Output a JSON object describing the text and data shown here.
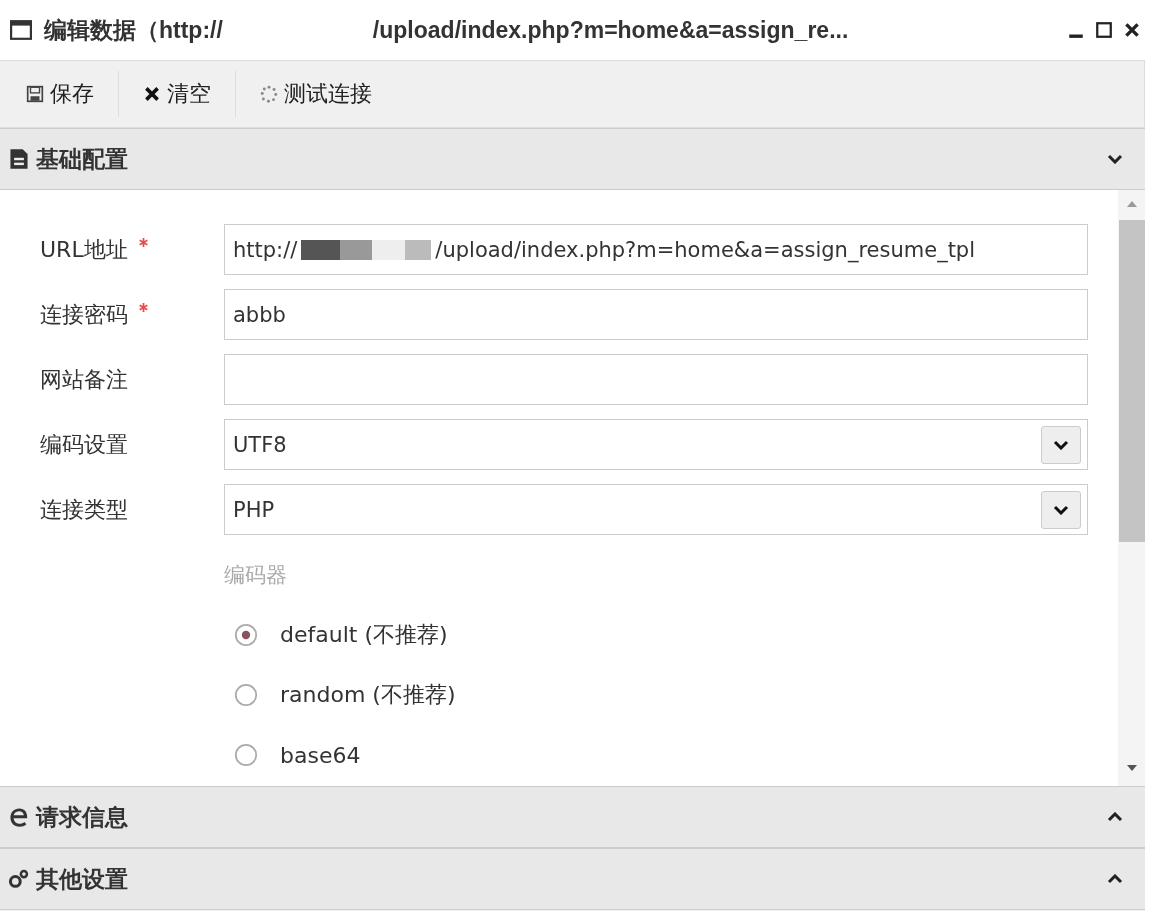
{
  "window": {
    "title_parts": [
      "编辑数据（http://",
      "/upload/index.php?m=home&a=assign_re..."
    ]
  },
  "toolbar": [
    {
      "label": "保存"
    },
    {
      "label": "清空"
    },
    {
      "label": "测试连接"
    }
  ],
  "sections": [
    {
      "title": "基础配置",
      "expanded": true
    },
    {
      "title": "请求信息",
      "expanded": false
    },
    {
      "title": "其他设置",
      "expanded": false
    }
  ],
  "fields": [
    {
      "kind": "text",
      "label": "URL地址",
      "required": true,
      "value_parts": [
        "http://",
        "/upload/index.php?m=home&a=assign_resume_tpl"
      ]
    },
    {
      "kind": "text",
      "label": "连接密码",
      "required": true,
      "value_parts": [
        "abbb"
      ]
    },
    {
      "kind": "text",
      "label": "网站备注",
      "required": false
    },
    {
      "kind": "select",
      "label": "编码设置",
      "required": false,
      "value_parts": [
        "UTF8"
      ]
    },
    {
      "kind": "select",
      "label": "连接类型",
      "required": false,
      "value_parts": [
        "PHP"
      ]
    }
  ],
  "encoder": {
    "label": "编码器",
    "options": [
      {
        "label": "default (不推荐)",
        "selected": true
      },
      {
        "label": "random (不推荐)",
        "selected": false
      },
      {
        "label": "base64",
        "selected": false
      }
    ]
  }
}
